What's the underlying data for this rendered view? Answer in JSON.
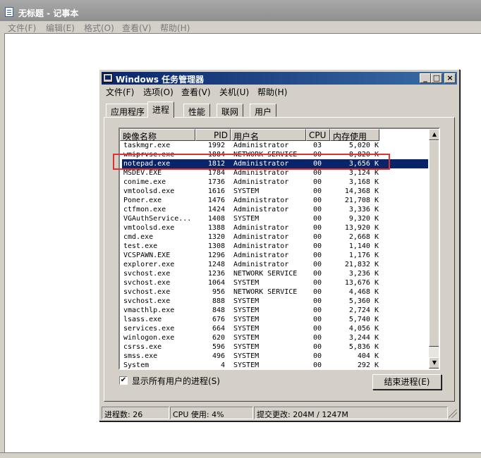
{
  "notepad": {
    "title": "无标题 - 记事本",
    "menu": [
      "文件(F)",
      "编辑(E)",
      "格式(O)",
      "查看(V)",
      "帮助(H)"
    ]
  },
  "taskmgr": {
    "title": "Windows 任务管理器",
    "menu": [
      "文件(F)",
      "选项(O)",
      "查看(V)",
      "关机(U)",
      "帮助(H)"
    ],
    "title_buttons": [
      "_",
      "□",
      "×"
    ],
    "tabs": [
      "应用程序",
      "进程",
      "性能",
      "联网",
      "用户"
    ],
    "active_tab": "进程",
    "columns": [
      "映像名称",
      "PID",
      "用户名",
      "CPU",
      "内存使用"
    ],
    "processes": [
      {
        "name": "taskmgr.exe",
        "pid": "1992",
        "user": "Administrator",
        "cpu": "03",
        "mem": "5,020 K"
      },
      {
        "name": "wmiprvse.exe",
        "pid": "1884",
        "user": "NETWORK SERVICE",
        "cpu": "00",
        "mem": "8,820 K"
      },
      {
        "name": "notepad.exe",
        "pid": "1812",
        "user": "Administrator",
        "cpu": "00",
        "mem": "3,656 K",
        "selected": true
      },
      {
        "name": "MSDEV.EXE",
        "pid": "1784",
        "user": "Administrator",
        "cpu": "00",
        "mem": "3,124 K"
      },
      {
        "name": "conime.exe",
        "pid": "1736",
        "user": "Administrator",
        "cpu": "00",
        "mem": "3,168 K"
      },
      {
        "name": "vmtoolsd.exe",
        "pid": "1616",
        "user": "SYSTEM",
        "cpu": "00",
        "mem": "14,368 K"
      },
      {
        "name": "Poner.exe",
        "pid": "1476",
        "user": "Administrator",
        "cpu": "00",
        "mem": "21,708 K"
      },
      {
        "name": "ctfmon.exe",
        "pid": "1424",
        "user": "Administrator",
        "cpu": "00",
        "mem": "3,336 K"
      },
      {
        "name": "VGAuthService...",
        "pid": "1408",
        "user": "SYSTEM",
        "cpu": "00",
        "mem": "9,320 K"
      },
      {
        "name": "vmtoolsd.exe",
        "pid": "1388",
        "user": "Administrator",
        "cpu": "00",
        "mem": "13,920 K"
      },
      {
        "name": "cmd.exe",
        "pid": "1320",
        "user": "Administrator",
        "cpu": "00",
        "mem": "2,668 K"
      },
      {
        "name": "test.exe",
        "pid": "1308",
        "user": "Administrator",
        "cpu": "00",
        "mem": "1,140 K"
      },
      {
        "name": "VCSPAWN.EXE",
        "pid": "1296",
        "user": "Administrator",
        "cpu": "00",
        "mem": "1,176 K"
      },
      {
        "name": "explorer.exe",
        "pid": "1248",
        "user": "Administrator",
        "cpu": "00",
        "mem": "21,832 K"
      },
      {
        "name": "svchost.exe",
        "pid": "1236",
        "user": "NETWORK SERVICE",
        "cpu": "00",
        "mem": "3,236 K"
      },
      {
        "name": "svchost.exe",
        "pid": "1064",
        "user": "SYSTEM",
        "cpu": "00",
        "mem": "13,676 K"
      },
      {
        "name": "svchost.exe",
        "pid": "956",
        "user": "NETWORK SERVICE",
        "cpu": "00",
        "mem": "4,468 K"
      },
      {
        "name": "svchost.exe",
        "pid": "888",
        "user": "SYSTEM",
        "cpu": "00",
        "mem": "5,360 K"
      },
      {
        "name": "vmacthlp.exe",
        "pid": "848",
        "user": "SYSTEM",
        "cpu": "00",
        "mem": "2,724 K"
      },
      {
        "name": "lsass.exe",
        "pid": "676",
        "user": "SYSTEM",
        "cpu": "00",
        "mem": "5,740 K"
      },
      {
        "name": "services.exe",
        "pid": "664",
        "user": "SYSTEM",
        "cpu": "00",
        "mem": "4,056 K"
      },
      {
        "name": "winlogon.exe",
        "pid": "620",
        "user": "SYSTEM",
        "cpu": "00",
        "mem": "3,244 K"
      },
      {
        "name": "csrss.exe",
        "pid": "596",
        "user": "SYSTEM",
        "cpu": "00",
        "mem": "5,836 K"
      },
      {
        "name": "smss.exe",
        "pid": "496",
        "user": "SYSTEM",
        "cpu": "00",
        "mem": "404 K"
      },
      {
        "name": "System",
        "pid": "4",
        "user": "SYSTEM",
        "cpu": "00",
        "mem": "292 K"
      }
    ],
    "show_all_users_label": "显示所有用户的进程(S)",
    "show_all_users_checked": true,
    "end_process_label": "结束进程(E)",
    "status": {
      "process_count": "进程数: 26",
      "cpu_usage": "CPU 使用: 4%",
      "commit_charge": "提交更改: 204M / 1247M"
    },
    "highlight_color": "#e03030",
    "selection_color": "#0a246a"
  }
}
